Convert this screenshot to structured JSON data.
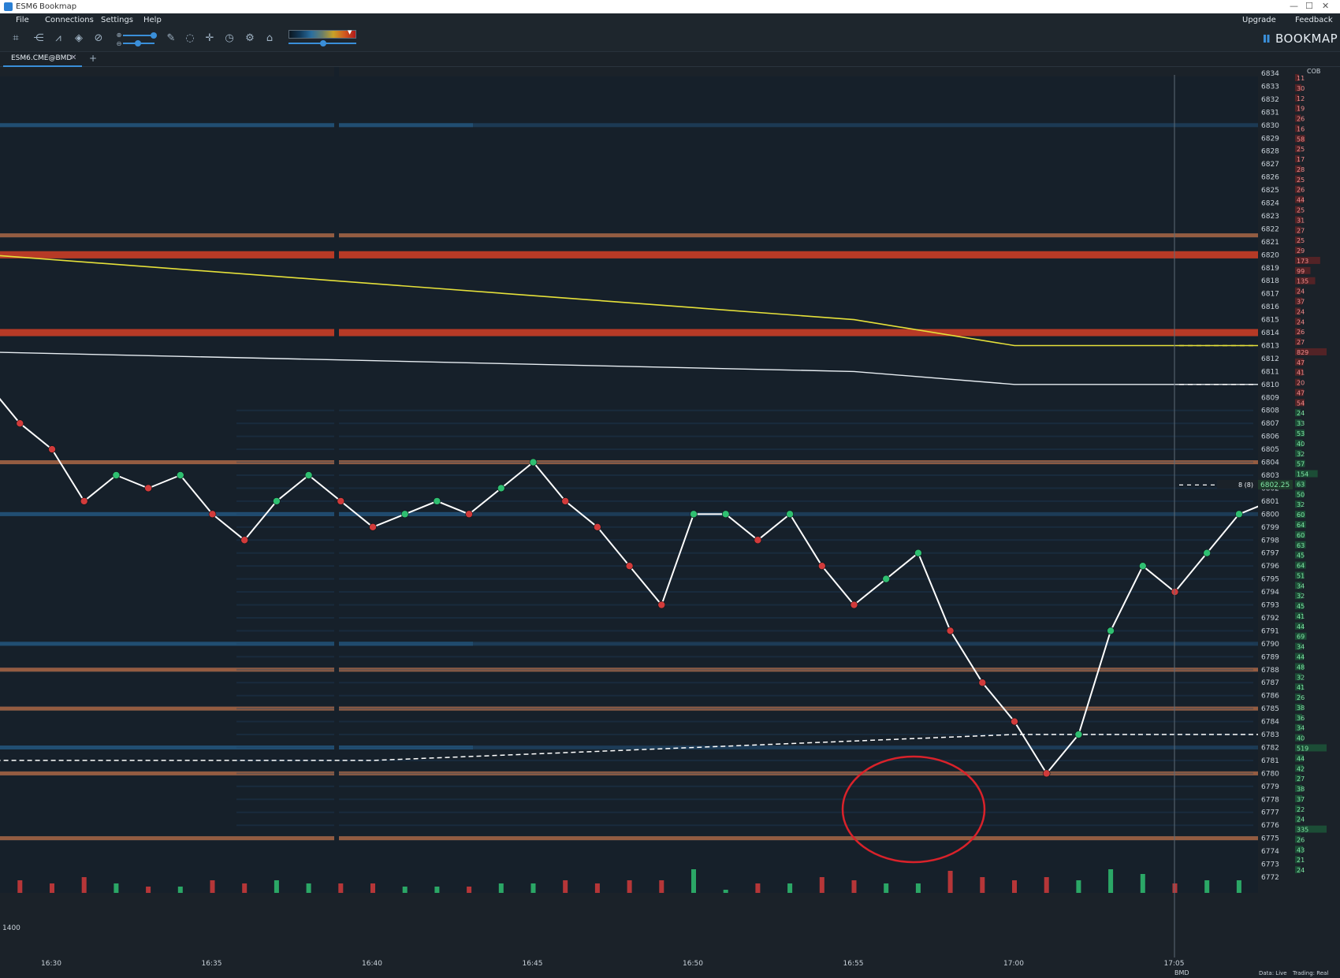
{
  "window": {
    "title_short": "ESM6",
    "title_app": "Bookmap",
    "controls": [
      "—",
      "☐",
      "✕"
    ]
  },
  "menu": {
    "items": [
      "File",
      "Connections",
      "Settings",
      "Help"
    ],
    "right_items": [
      "Upgrade",
      "Feedback"
    ]
  },
  "toolbar": {
    "icons": [
      "screenshot-icon",
      "share-icon",
      "chart-indicators-icon",
      "diamond-icon",
      "link-icon",
      "pen-icon",
      "chat-icon",
      "crosshair-icon",
      "timer-icon",
      "settings-sliders-icon",
      "lock-icon"
    ],
    "brand": "BOOKMAP"
  },
  "tabs": [
    {
      "label": "ESM6.CME@BMD",
      "close": "✕"
    }
  ],
  "tab_add": "+",
  "cob_label": "COB",
  "price_axis": {
    "min": 6772,
    "max": 6834,
    "current_price": "6802.25",
    "current_prefix": "8 (8)"
  },
  "cob_values": [
    "11",
    "30",
    "12",
    "19",
    "26",
    "16",
    "58",
    "25",
    "17",
    "28",
    "25",
    "26",
    "44",
    "25",
    "31",
    "27",
    "25",
    "29",
    "173",
    "99",
    "135",
    "24",
    "37",
    "24",
    "24",
    "26",
    "27",
    "829",
    "47",
    "41",
    "20",
    "47",
    "54",
    "24",
    "33",
    "53",
    "40",
    "32",
    "57",
    "154",
    "63",
    "50",
    "32",
    "60",
    "64",
    "60",
    "63",
    "45",
    "64",
    "51",
    "34",
    "32",
    "45",
    "41",
    "44",
    "69",
    "34",
    "44",
    "48",
    "32",
    "41",
    "26",
    "38",
    "36",
    "34",
    "40",
    "519",
    "44",
    "42",
    "27",
    "38",
    "37",
    "22",
    "24",
    "335",
    "26",
    "43",
    "21",
    "24"
  ],
  "time_axis": {
    "labels": [
      "16:30",
      "16:35",
      "16:40",
      "16:45",
      "16:50",
      "16:55",
      "17:00",
      "17:05"
    ]
  },
  "volume_scale_label": "1400",
  "status_bar": {
    "source": "BMD",
    "data_status": "Data: Live",
    "trading_status": "Trading: Real"
  },
  "colors": {
    "background": "#1b2229",
    "accent": "#3a8fd9",
    "buy": "#2fbf71",
    "sell": "#d23b3b",
    "vwap_yellow": "#e6e13a",
    "annotation_circle": "#d9222a"
  },
  "chart_data": {
    "type": "line",
    "x_labels": [
      "16:30",
      "16:35",
      "16:40",
      "16:45",
      "16:50",
      "16:55",
      "17:00",
      "17:05"
    ],
    "ylim": [
      6772,
      6834
    ],
    "price_series": [
      {
        "t": "16:28",
        "p": 6810
      },
      {
        "t": "16:29",
        "p": 6807
      },
      {
        "t": "16:30",
        "p": 6805
      },
      {
        "t": "16:31",
        "p": 6801
      },
      {
        "t": "16:32",
        "p": 6803
      },
      {
        "t": "16:33",
        "p": 6802
      },
      {
        "t": "16:34",
        "p": 6803
      },
      {
        "t": "16:35",
        "p": 6800
      },
      {
        "t": "16:36",
        "p": 6798
      },
      {
        "t": "16:37",
        "p": 6801
      },
      {
        "t": "16:38",
        "p": 6803
      },
      {
        "t": "16:39",
        "p": 6801
      },
      {
        "t": "16:40",
        "p": 6799
      },
      {
        "t": "16:41",
        "p": 6800
      },
      {
        "t": "16:42",
        "p": 6801
      },
      {
        "t": "16:43",
        "p": 6800
      },
      {
        "t": "16:44",
        "p": 6802
      },
      {
        "t": "16:45",
        "p": 6804
      },
      {
        "t": "16:46",
        "p": 6801
      },
      {
        "t": "16:47",
        "p": 6799
      },
      {
        "t": "16:48",
        "p": 6796
      },
      {
        "t": "16:49",
        "p": 6793
      },
      {
        "t": "16:50",
        "p": 6800
      },
      {
        "t": "16:51",
        "p": 6800
      },
      {
        "t": "16:52",
        "p": 6798
      },
      {
        "t": "16:53",
        "p": 6800
      },
      {
        "t": "16:54",
        "p": 6796
      },
      {
        "t": "16:55",
        "p": 6793
      },
      {
        "t": "16:56",
        "p": 6795
      },
      {
        "t": "16:57",
        "p": 6797
      },
      {
        "t": "16:58",
        "p": 6791
      },
      {
        "t": "16:59",
        "p": 6787
      },
      {
        "t": "17:00",
        "p": 6784
      },
      {
        "t": "17:01",
        "p": 6780
      },
      {
        "t": "17:02",
        "p": 6783
      },
      {
        "t": "17:03",
        "p": 6791
      },
      {
        "t": "17:04",
        "p": 6796
      },
      {
        "t": "17:05",
        "p": 6794
      },
      {
        "t": "17:06",
        "p": 6797
      },
      {
        "t": "17:07",
        "p": 6800
      },
      {
        "t": "17:08",
        "p": 6801
      },
      {
        "t": "17:09",
        "p": 6804
      },
      {
        "t": "17:10",
        "p": 6802
      }
    ],
    "vwap_yellow": [
      {
        "t": "16:28",
        "p": 6820
      },
      {
        "t": "16:55",
        "p": 6815
      },
      {
        "t": "17:00",
        "p": 6813
      },
      {
        "t": "17:10",
        "p": 6813
      }
    ],
    "vwap_white": [
      {
        "t": "16:28",
        "p": 6812.5
      },
      {
        "t": "16:55",
        "p": 6811
      },
      {
        "t": "17:00",
        "p": 6810
      },
      {
        "t": "17:10",
        "p": 6810
      }
    ],
    "vwap_dashed": [
      {
        "t": "16:28",
        "p": 6781
      },
      {
        "t": "16:40",
        "p": 6781
      },
      {
        "t": "16:50",
        "p": 6782
      },
      {
        "t": "17:00",
        "p": 6783
      },
      {
        "t": "17:10",
        "p": 6783
      }
    ],
    "liquidity_levels": [
      {
        "p": 6820,
        "intensity": "high"
      },
      {
        "p": 6814,
        "intensity": "high"
      },
      {
        "p": 6821.5,
        "intensity": "medium"
      },
      {
        "p": 6830,
        "intensity": "low"
      },
      {
        "p": 6788,
        "intensity": "medium"
      },
      {
        "p": 6785,
        "intensity": "medium"
      },
      {
        "p": 6782,
        "intensity": "low"
      },
      {
        "p": 6780,
        "intensity": "medium"
      },
      {
        "p": 6775,
        "intensity": "medium"
      },
      {
        "p": 6790,
        "intensity": "low"
      },
      {
        "p": 6800,
        "intensity": "low"
      },
      {
        "p": 6804,
        "intensity": "medium"
      }
    ],
    "annotation": {
      "type": "circle",
      "center_time": "17:01",
      "center_price": 6782,
      "color": "#d9222a"
    }
  }
}
